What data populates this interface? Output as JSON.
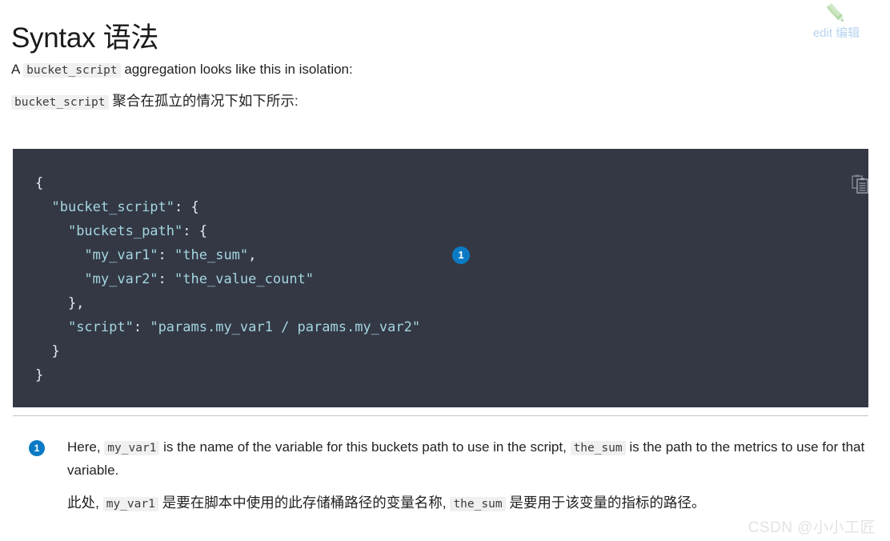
{
  "heading": "Syntax 语法",
  "edit": {
    "icon": "pencil-icon",
    "label": "edit 编辑",
    "icon_color": "#c3e2bb",
    "label_color": "#b7d4ef"
  },
  "intro": {
    "en": {
      "before": "A ",
      "code": "bucket_script",
      "after": " aggregation looks like this in isolation:"
    },
    "zh": {
      "code": "bucket_script",
      "after": " 聚合在孤立的情况下如下所示:"
    }
  },
  "code_block": {
    "background": "#343845",
    "copy_icon": "copy-clipboard-icon",
    "string_color": "#a3d6e0",
    "punct_color": "#e8ebf0",
    "lines": [
      [
        {
          "t": "{",
          "c": "punct"
        }
      ],
      [
        {
          "t": "  ",
          "c": "punct"
        },
        {
          "t": "\"bucket_script\"",
          "c": "str"
        },
        {
          "t": ": {",
          "c": "punct"
        }
      ],
      [
        {
          "t": "    ",
          "c": "punct"
        },
        {
          "t": "\"buckets_path\"",
          "c": "str"
        },
        {
          "t": ": {",
          "c": "punct"
        }
      ],
      [
        {
          "t": "      ",
          "c": "punct"
        },
        {
          "t": "\"my_var1\"",
          "c": "str"
        },
        {
          "t": ": ",
          "c": "punct"
        },
        {
          "t": "\"the_sum\"",
          "c": "str"
        },
        {
          "t": ",",
          "c": "punct"
        }
      ],
      [
        {
          "t": "      ",
          "c": "punct"
        },
        {
          "t": "\"my_var2\"",
          "c": "str"
        },
        {
          "t": ": ",
          "c": "punct"
        },
        {
          "t": "\"the_value_count\"",
          "c": "str"
        }
      ],
      [
        {
          "t": "    },",
          "c": "punct"
        }
      ],
      [
        {
          "t": "    ",
          "c": "punct"
        },
        {
          "t": "\"script\"",
          "c": "str"
        },
        {
          "t": ": ",
          "c": "punct"
        },
        {
          "t": "\"params.my_var1 / params.my_var2\"",
          "c": "str"
        }
      ],
      [
        {
          "t": "  }",
          "c": "punct"
        }
      ],
      [
        {
          "t": "}",
          "c": "punct"
        }
      ]
    ],
    "marker": "1",
    "marker_color": "#0b7ac4"
  },
  "callout": {
    "number": "1",
    "en": {
      "p1": "Here, ",
      "code1": "my_var1",
      "p2": " is the name of the variable for this buckets path to use in the script, ",
      "code2": "the_sum",
      "p3": " is the path to the metrics to use for that variable."
    },
    "zh": {
      "p1": "此处, ",
      "code1": "my_var1",
      "p2": " 是要在脚本中使用的此存储桶路径的变量名称, ",
      "code2": "the_sum",
      "p3": " 是要用于该变量的指标的路径。"
    }
  },
  "watermark": "CSDN @小小工匠"
}
